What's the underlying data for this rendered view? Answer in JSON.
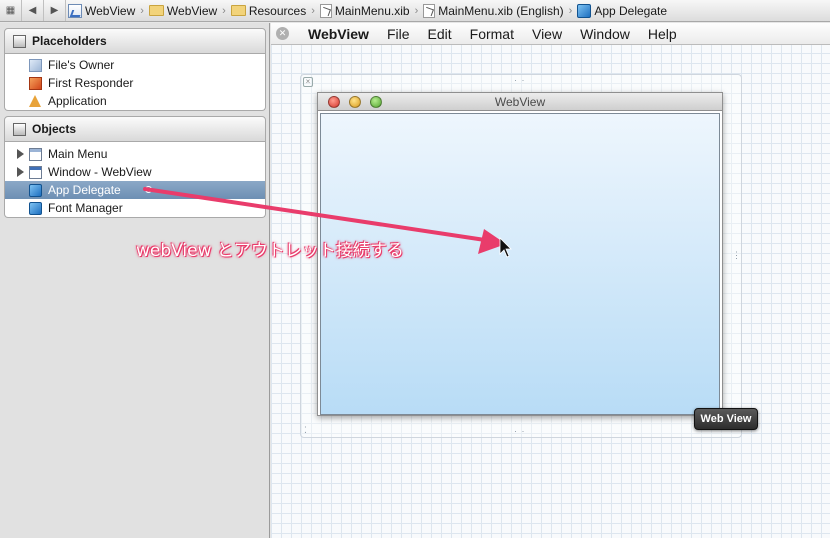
{
  "jumpbar": {
    "crumbs": [
      {
        "label": "WebView",
        "icon": "project-icon"
      },
      {
        "label": "WebView",
        "icon": "folder-icon"
      },
      {
        "label": "Resources",
        "icon": "folder-icon"
      },
      {
        "label": "MainMenu.xib",
        "icon": "xib-icon"
      },
      {
        "label": "MainMenu.xib (English)",
        "icon": "xib-icon"
      },
      {
        "label": "App Delegate",
        "icon": "cube-icon"
      }
    ]
  },
  "placeholders": {
    "title": "Placeholders",
    "items": [
      {
        "label": "File's Owner"
      },
      {
        "label": "First Responder"
      },
      {
        "label": "Application"
      }
    ]
  },
  "objects": {
    "title": "Objects",
    "items": [
      {
        "label": "Main Menu"
      },
      {
        "label": "Window - WebView"
      },
      {
        "label": "App Delegate"
      },
      {
        "label": "Font Manager"
      }
    ]
  },
  "menubar": {
    "items": [
      "WebView",
      "File",
      "Edit",
      "Format",
      "View",
      "Window",
      "Help"
    ]
  },
  "window": {
    "title": "WebView"
  },
  "badge": {
    "label": "Web View"
  },
  "annotation": {
    "text": "webView とアウトレット接続する"
  },
  "colors": {
    "arrow": "#e93c6b",
    "selection": "#7595b9",
    "webview_top": "#eef6fd",
    "webview_bottom": "#b8dcf6"
  }
}
